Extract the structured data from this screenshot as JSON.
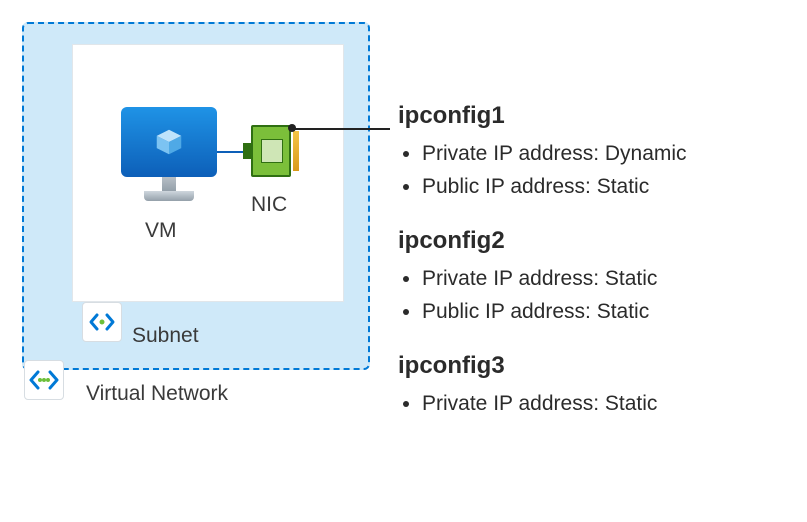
{
  "vnet": {
    "label": "Virtual Network"
  },
  "subnet": {
    "label": "Subnet"
  },
  "vm": {
    "label": "VM"
  },
  "nic": {
    "label": "NIC"
  },
  "ipconfigs": [
    {
      "name": "ipconfig1",
      "lines": [
        "Private IP address: Dynamic",
        "Public IP address: Static"
      ]
    },
    {
      "name": "ipconfig2",
      "lines": [
        "Private IP address: Static",
        "Public IP address: Static"
      ]
    },
    {
      "name": "ipconfig3",
      "lines": [
        "Private IP address: Static"
      ]
    }
  ]
}
